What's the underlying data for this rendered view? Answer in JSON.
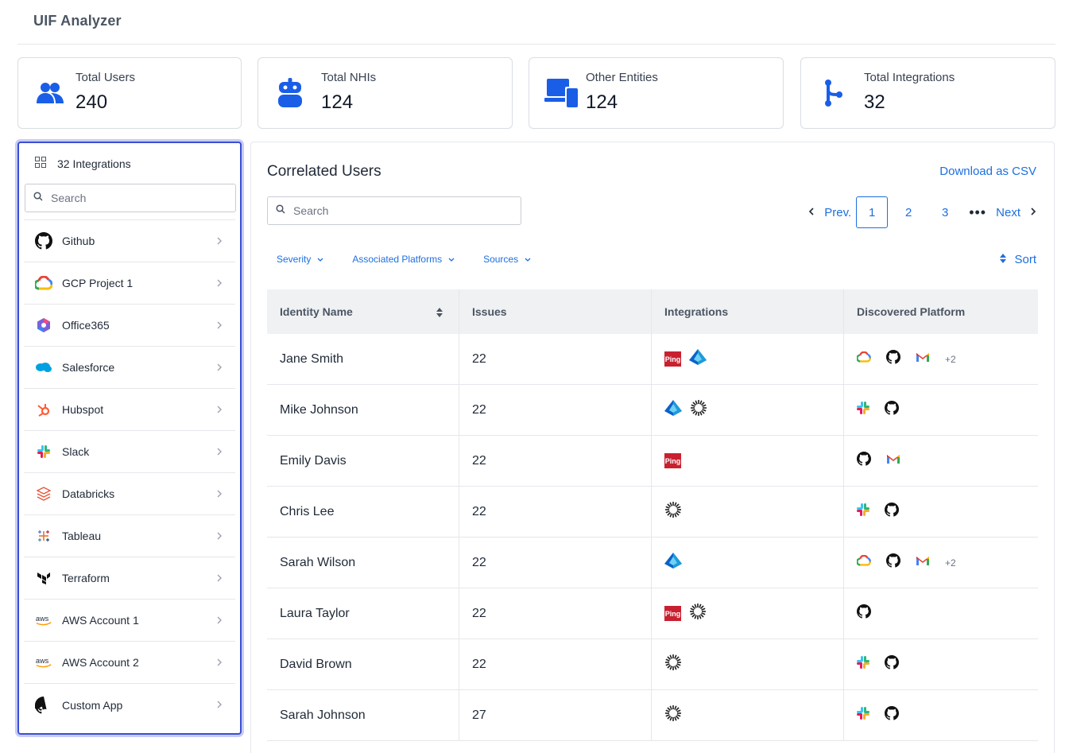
{
  "app": {
    "title": "UIF Analyzer"
  },
  "stats": [
    {
      "label": "Total Users",
      "value": "240",
      "icon": "users-icon"
    },
    {
      "label": "Total NHIs",
      "value": "124",
      "icon": "robot-icon"
    },
    {
      "label": "Other Entities",
      "value": "124",
      "icon": "devices-icon"
    },
    {
      "label": "Total Integrations",
      "value": "32",
      "icon": "branch-icon"
    }
  ],
  "sidebar": {
    "header": "32 Integrations",
    "search_placeholder": "Search",
    "items": [
      {
        "label": "Github",
        "icon": "github-icon"
      },
      {
        "label": "GCP Project 1",
        "icon": "gcp-icon"
      },
      {
        "label": "Office365",
        "icon": "office365-icon"
      },
      {
        "label": "Salesforce",
        "icon": "salesforce-icon"
      },
      {
        "label": "Hubspot",
        "icon": "hubspot-icon"
      },
      {
        "label": "Slack",
        "icon": "slack-icon"
      },
      {
        "label": "Databricks",
        "icon": "databricks-icon"
      },
      {
        "label": "Tableau",
        "icon": "tableau-icon"
      },
      {
        "label": "Terraform",
        "icon": "terraform-icon"
      },
      {
        "label": "AWS Account 1",
        "icon": "aws-icon"
      },
      {
        "label": "AWS Account 2",
        "icon": "aws-icon"
      },
      {
        "label": "Custom App",
        "icon": "github-icon"
      }
    ]
  },
  "main": {
    "title": "Correlated Users",
    "download_label": "Download as CSV",
    "search_placeholder": "Search",
    "pagination": {
      "prev": "Prev.",
      "pages": [
        "1",
        "2",
        "3"
      ],
      "current": "1",
      "ellipsis": "•••",
      "next": "Next"
    },
    "filters": [
      "Severity",
      "Associated Platforms",
      "Sources"
    ],
    "sort_label": "Sort",
    "columns": [
      "Identity Name",
      "Issues",
      "Integrations",
      "Discovered Platform"
    ],
    "rows": [
      {
        "name": "Jane Smith",
        "issues": "22",
        "integrations": [
          "ping",
          "azure"
        ],
        "platforms": [
          "gcp",
          "github",
          "gmail"
        ],
        "more": "+2"
      },
      {
        "name": "Mike Johnson",
        "issues": "22",
        "integrations": [
          "azure",
          "okta"
        ],
        "platforms": [
          "slack",
          "github"
        ],
        "more": ""
      },
      {
        "name": "Emily Davis",
        "issues": "22",
        "integrations": [
          "ping"
        ],
        "platforms": [
          "github",
          "gmail"
        ],
        "more": ""
      },
      {
        "name": "Chris Lee",
        "issues": "22",
        "integrations": [
          "okta"
        ],
        "platforms": [
          "slack",
          "github"
        ],
        "more": ""
      },
      {
        "name": "Sarah Wilson",
        "issues": "22",
        "integrations": [
          "azure"
        ],
        "platforms": [
          "gcp",
          "github",
          "gmail"
        ],
        "more": "+2"
      },
      {
        "name": "Laura Taylor",
        "issues": "22",
        "integrations": [
          "ping",
          "okta"
        ],
        "platforms": [
          "github"
        ],
        "more": ""
      },
      {
        "name": "David Brown",
        "issues": "22",
        "integrations": [
          "okta"
        ],
        "platforms": [
          "slack",
          "github"
        ],
        "more": ""
      },
      {
        "name": "Sarah Johnson",
        "issues": "27",
        "integrations": [
          "okta"
        ],
        "platforms": [
          "slack",
          "github"
        ],
        "more": ""
      }
    ],
    "ping_text": "Ping"
  },
  "colors": {
    "accent": "#1d6fe0",
    "stat_icon": "#1a5ee8",
    "sidebar_border": "#3b4fd6"
  }
}
